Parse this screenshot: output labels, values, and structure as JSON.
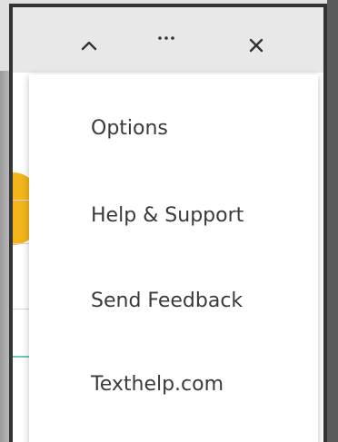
{
  "toolbar": {
    "collapse_icon": "chevron-up-icon",
    "more_icon": "more-horizontal-icon",
    "close_icon": "close-icon"
  },
  "menu": {
    "items": [
      {
        "label": "Options"
      },
      {
        "label": "Help & Support"
      },
      {
        "label": "Send Feedback"
      },
      {
        "label": "Texthelp.com"
      }
    ]
  },
  "colors": {
    "accent_yellow": "#f3b51c",
    "accent_teal": "#6cc7c0",
    "text": "#3a3a3a",
    "frame_border": "#333333"
  }
}
